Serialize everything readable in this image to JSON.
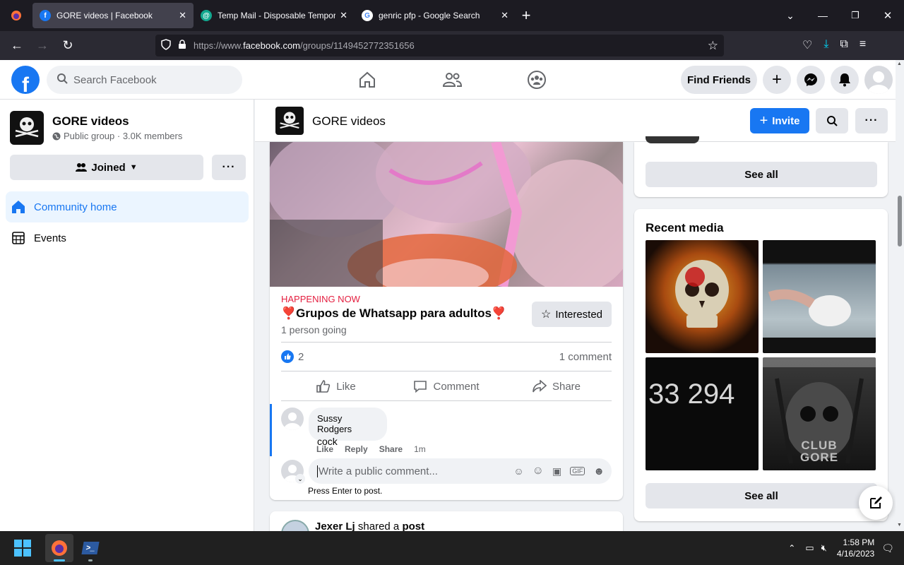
{
  "browser": {
    "tabs": [
      {
        "title": "GORE videos | Facebook",
        "active": true,
        "icon": "facebook-icon"
      },
      {
        "title": "Temp Mail - Disposable Tempor",
        "active": false,
        "icon": "tempmail-icon"
      },
      {
        "title": "genric pfp - Google Search",
        "active": false,
        "icon": "google-icon"
      }
    ],
    "url_prefix": "https://www.",
    "url_domain": "facebook.com",
    "url_path": "/groups/1149452772351656"
  },
  "fb": {
    "search_placeholder": "Search Facebook",
    "find_friends": "Find Friends",
    "logo_letter": "f"
  },
  "group": {
    "name": "GORE videos",
    "privacy": "Public group · 3.0K members",
    "joined_label": "Joined",
    "nav": [
      {
        "label": "Community home",
        "active": true,
        "icon": "home-icon"
      },
      {
        "label": "Events",
        "active": false,
        "icon": "calendar-icon"
      }
    ],
    "invite_label": "Invite"
  },
  "event": {
    "status": "HAPPENING NOW",
    "title": "❣️Grupos de Whatsapp para adultos❣️",
    "going": "1 person going",
    "interested_label": "Interested"
  },
  "post": {
    "reaction_count": "2",
    "comment_count": "1 comment",
    "actions": [
      "Like",
      "Comment",
      "Share"
    ],
    "comment": {
      "author": "Sussy Rodgers",
      "text": "cock",
      "actions": [
        "Like",
        "Reply",
        "Share"
      ],
      "time": "1m"
    },
    "comment_placeholder": "Write a public comment...",
    "press_enter": "Press Enter to post.",
    "next_author": "Jexer Lj",
    "next_shared": "shared a",
    "next_post": "post"
  },
  "right": {
    "see_all_1": "See all",
    "recent_media_title": "Recent media",
    "media_text": "33 294",
    "club_text": "CLUB GORE",
    "see_all_2": "See all"
  },
  "taskbar": {
    "time": "1:58 PM",
    "date": "4/16/2023"
  },
  "colors": {
    "brand": "#1877f2",
    "happening": "#e41e3f",
    "tabbar": "#1c1b22"
  }
}
